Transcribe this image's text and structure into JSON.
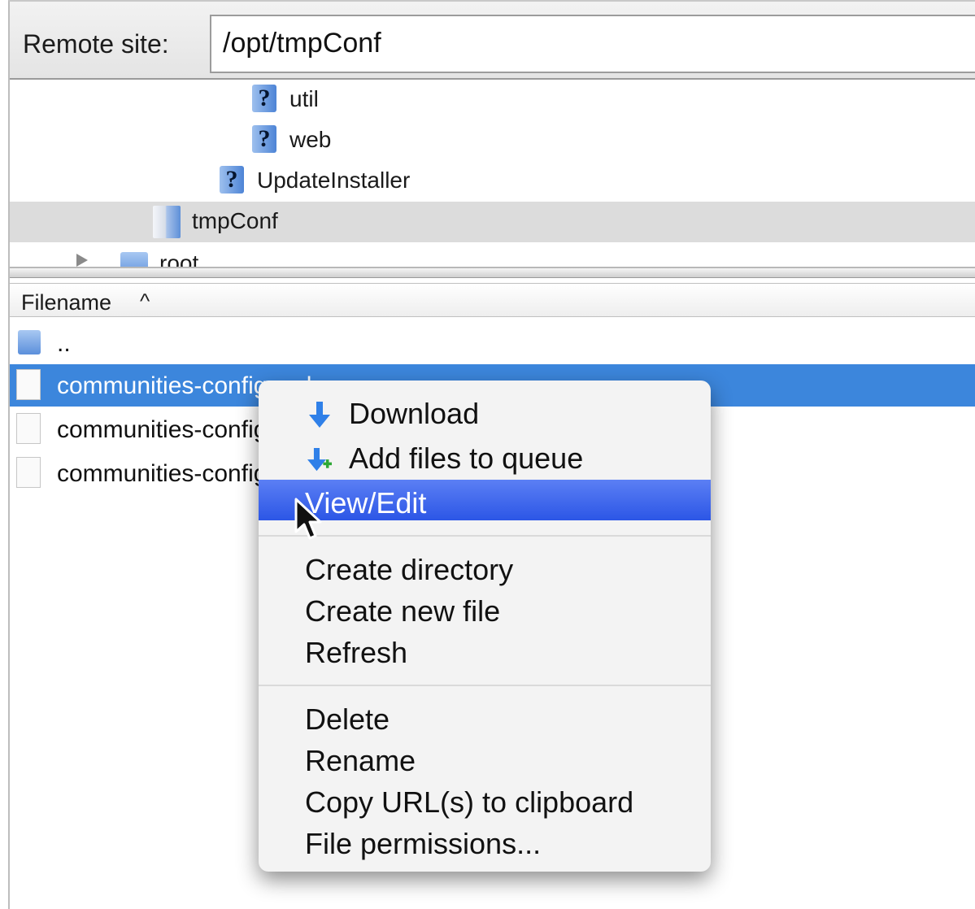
{
  "remote_site": {
    "label": "Remote site:",
    "path": "/opt/tmpConf"
  },
  "tree": {
    "items": [
      {
        "label": "util",
        "icon": "unknown-folder-icon"
      },
      {
        "label": "web",
        "icon": "unknown-folder-icon"
      },
      {
        "label": "UpdateInstaller",
        "icon": "unknown-folder-icon"
      },
      {
        "label": "tmpConf",
        "icon": "open-folder-icon",
        "selected": true
      },
      {
        "label": "root",
        "icon": "folder-icon"
      }
    ]
  },
  "file_list": {
    "column_header": "Filename",
    "sort_indicator": "^",
    "rows": [
      {
        "name": "..",
        "icon": "folder-icon"
      },
      {
        "name": "communities-config.xml",
        "icon": "file-icon",
        "selected": true
      },
      {
        "name": "communities-config.xml",
        "icon": "file-icon"
      },
      {
        "name": "communities-config.xml",
        "icon": "file-icon"
      }
    ]
  },
  "context_menu": {
    "items": [
      {
        "label": "Download",
        "icon": "download-arrow-icon"
      },
      {
        "label": "Add files to queue",
        "icon": "add-to-queue-icon"
      },
      {
        "label": "View/Edit",
        "hovered": true
      },
      {
        "label": "Create directory"
      },
      {
        "label": "Create new file"
      },
      {
        "label": "Refresh"
      },
      {
        "label": "Delete"
      },
      {
        "label": "Rename"
      },
      {
        "label": "Copy URL(s) to clipboard"
      },
      {
        "label": "File permissions..."
      }
    ]
  },
  "colors": {
    "selection_blue": "#3c86dc",
    "menu_hover": "#3f66ec",
    "tree_selected": "#dcdcdc"
  }
}
